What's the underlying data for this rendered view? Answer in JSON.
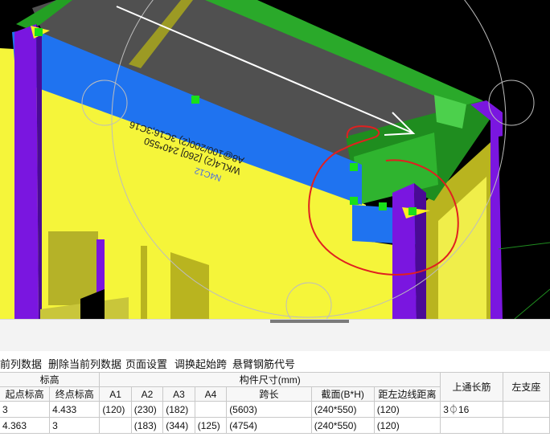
{
  "toolbar": {
    "items": [
      "前列数据",
      "删除当前列数据",
      "页面设置",
      "调换起始跨",
      "悬臂钢筋代号"
    ]
  },
  "viewport": {
    "beam_label_1": "WKL4(2) [260] 240*550",
    "beam_label_2": "A8@100/200(2) 3C16;3C16",
    "beam_label_3": "N4C12"
  },
  "table": {
    "group_headers": {
      "elevation": "标高",
      "dimensions": "构件尺寸(mm)",
      "top_long_rebar": "上通长筋",
      "left_support": "左支座"
    },
    "columns": [
      "起点标高",
      "终点标高",
      "A1",
      "A2",
      "A3",
      "A4",
      "跨长",
      "截面(B*H)",
      "距左边线距离"
    ],
    "rows": [
      [
        "3",
        "4.433",
        "(120)",
        "(230)",
        "(182)",
        "",
        "(5603)",
        "(240*550)",
        "(120)",
        "3⏀16",
        ""
      ],
      [
        "4.363",
        "3",
        "",
        "(183)",
        "(344)",
        "(125)",
        "(4754)",
        "(240*550)",
        "(120)",
        "",
        ""
      ]
    ]
  },
  "colors": {
    "wall_yellow": "#f5f53a",
    "column_purple": "#7a16e0",
    "beam_blue": "#1f73f0",
    "slab_green": "#2c9b2c",
    "grip_green": "#19e019",
    "annotation_red": "#e02020"
  }
}
